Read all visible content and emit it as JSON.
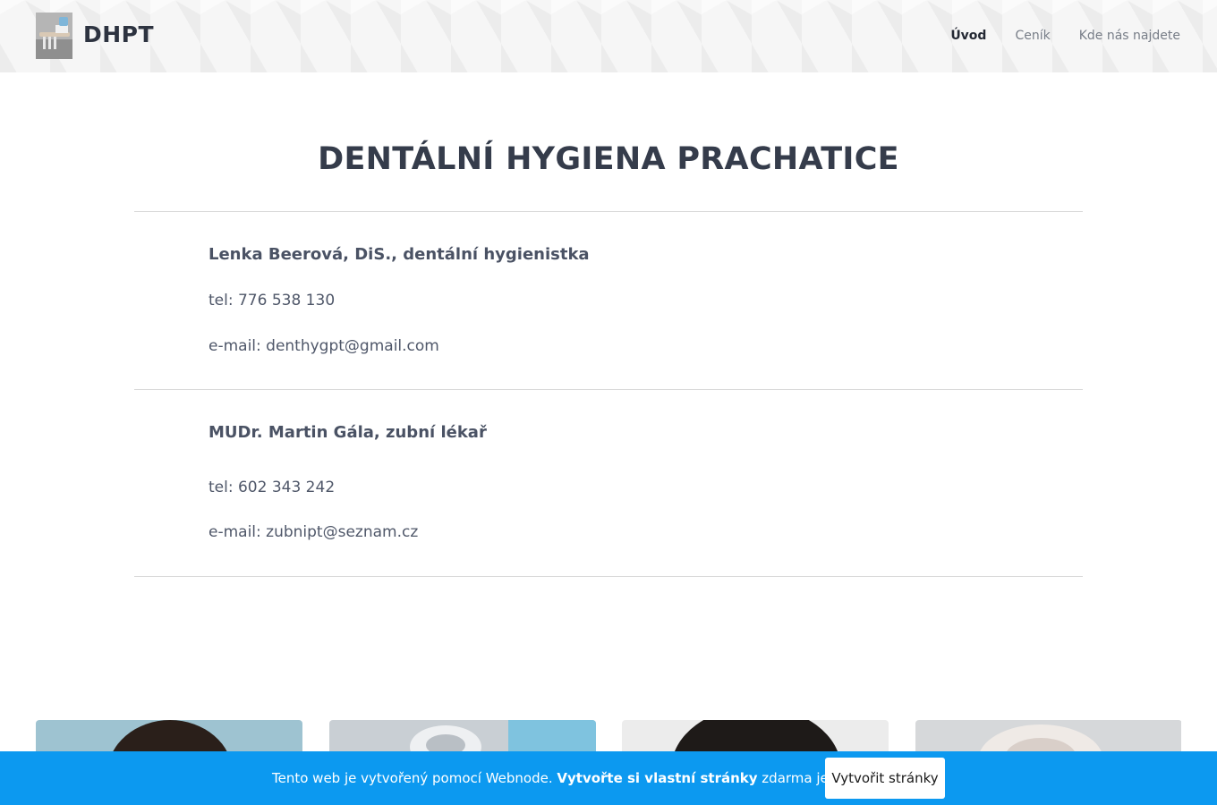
{
  "header": {
    "brand": "DHPT",
    "nav": [
      {
        "label": "Úvod",
        "active": true
      },
      {
        "label": "Ceník",
        "active": false
      },
      {
        "label": "Kde nás najdete",
        "active": false
      }
    ]
  },
  "main": {
    "title": "DENTÁLNÍ HYGIENA PRACHATICE",
    "contacts": [
      {
        "name": "Lenka Beerová, DiS., dentální hygienistka",
        "phone": "tel: 776 538 130",
        "email": "e-mail: denthygpt@gmail.com"
      },
      {
        "name": "MUDr. Martin Gála, zubní lékař",
        "phone": "tel: 602 343 242",
        "email": "e-mail: zubnipt@seznam.cz"
      }
    ]
  },
  "gallery": {
    "items": [
      {
        "icon": "photo-smiling-woman"
      },
      {
        "icon": "photo-dental-tools"
      },
      {
        "icon": "photo-woman-curly-hair"
      },
      {
        "icon": "photo-dental-close-up"
      }
    ]
  },
  "promo": {
    "text_before": "Tento web je vytvořený pomocí Webnode. ",
    "text_bold": "Vytvořte si vlastní stránky",
    "text_after": " zdarma ještě dnes!",
    "button_label": "Vytvořit stránky",
    "bg_color": "#0c99f0"
  }
}
